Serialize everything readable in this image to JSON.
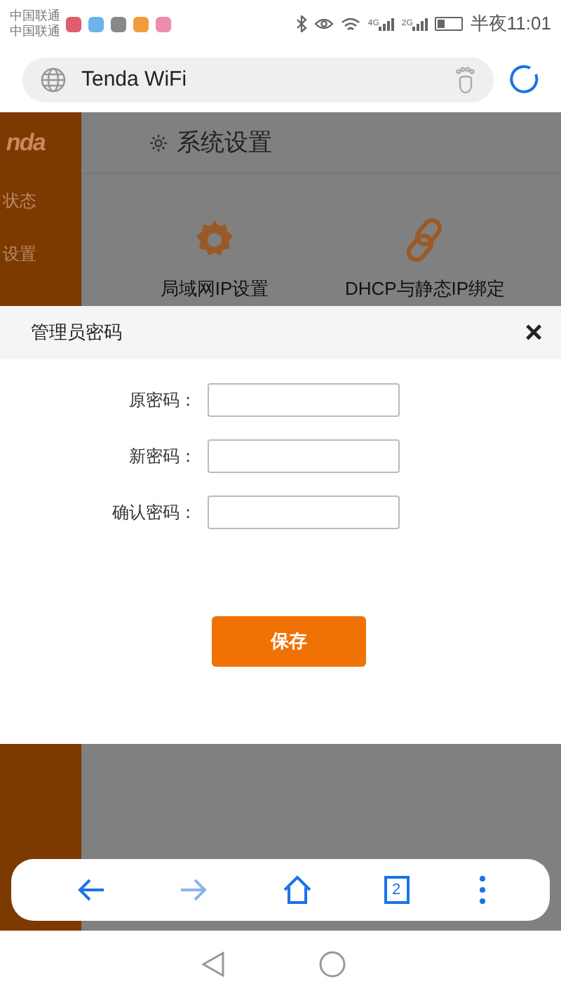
{
  "status_bar": {
    "carriers": [
      "中国联通",
      "中国联通"
    ],
    "network_labels": [
      "4G",
      "2G"
    ],
    "time": "半夜11:01"
  },
  "address_bar": {
    "title": "Tenda WiFi"
  },
  "sidebar": {
    "logo": "nda",
    "items": [
      "状态",
      "设置"
    ]
  },
  "page": {
    "title": "系统设置",
    "tiles": [
      {
        "kind": "ip",
        "label": "局域网IP设置"
      },
      {
        "kind": "link",
        "label": "DHCP与静态IP绑定"
      }
    ]
  },
  "dialog": {
    "title": "管理员密码",
    "close": "×",
    "fields": [
      {
        "label": "原密码："
      },
      {
        "label": "新密码："
      },
      {
        "label": "确认密码："
      }
    ],
    "save_button": "保存"
  },
  "toolbar": {
    "tab_count": "2"
  }
}
